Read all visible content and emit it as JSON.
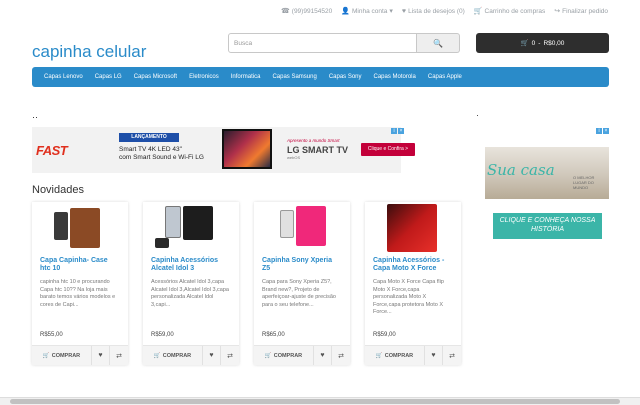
{
  "topbar": {
    "phone": "(99)99154520",
    "account": "Minha conta",
    "wishlist": "Lista de desejos (0)",
    "cart": "Carrinho de compras",
    "checkout": "Finalizar pedido"
  },
  "header": {
    "logo": "capinha celular",
    "search_placeholder": "Busca",
    "cart_count": "0",
    "cart_total": "R$0,00"
  },
  "nav": {
    "items": [
      "Capas Lenovo",
      "Capas LG",
      "Capas Microsoft",
      "Eletronicos",
      "Informatica",
      "Capas Samsung",
      "Capas Sony",
      "Capas Motorola",
      "Capas Apple"
    ]
  },
  "ad": {
    "brand": "FAST",
    "badge": "LANÇAMENTO",
    "product_line1": "Smart TV 4K LED 43\"",
    "product_line2": "com Smart Sound e Wi-Fi LG",
    "tagline": "Apresento a mundo Smart",
    "lg_text": "LG SMART TV",
    "lg_sub": "webOS",
    "cta": "Clique e Confira >"
  },
  "side_ad": {
    "script": "Sua casa",
    "sub": "O MELHOR LUGAR DO MUNDO",
    "cta": "CLIQUE E CONHEÇA NOSSA HISTÓRIA"
  },
  "section_title": "Novidades",
  "products": [
    {
      "title": "Capa Capinha- Case htc 10",
      "desc": "capinha htc 10 e procurando Capa htc 10?? Na loja mais barato temos vários modelos e cores de Capi...",
      "price": "R$55,00"
    },
    {
      "title": "Capinha Acessórios Alcatel Idol 3",
      "desc": "Acessórios Alcatel Idol 3,capa Alcatel Idol 3,Alcatel Idol 3,capa personalizada Alcatel Idol 3,capi...",
      "price": "R$59,00"
    },
    {
      "title": "Capinha Sony Xperia Z5",
      "desc": "Capa para Sony Xperia Z5?, Brand new?, Projeto de aperfeiçoar-ajuste de precisão para o seu telefone...",
      "price": "R$65,00"
    },
    {
      "title": "Capinha Acessórios - Capa Moto X Force",
      "desc": "Capa Moto X Force Capa flip Moto X Force,capa personalizada Moto X Force,capa protetora Moto X Force...",
      "price": "R$59,00"
    }
  ],
  "actions": {
    "buy": "COMPRAR"
  },
  "colors": {
    "brand_blue": "#2a8bc9",
    "cart_dark": "#2e2e2e"
  }
}
